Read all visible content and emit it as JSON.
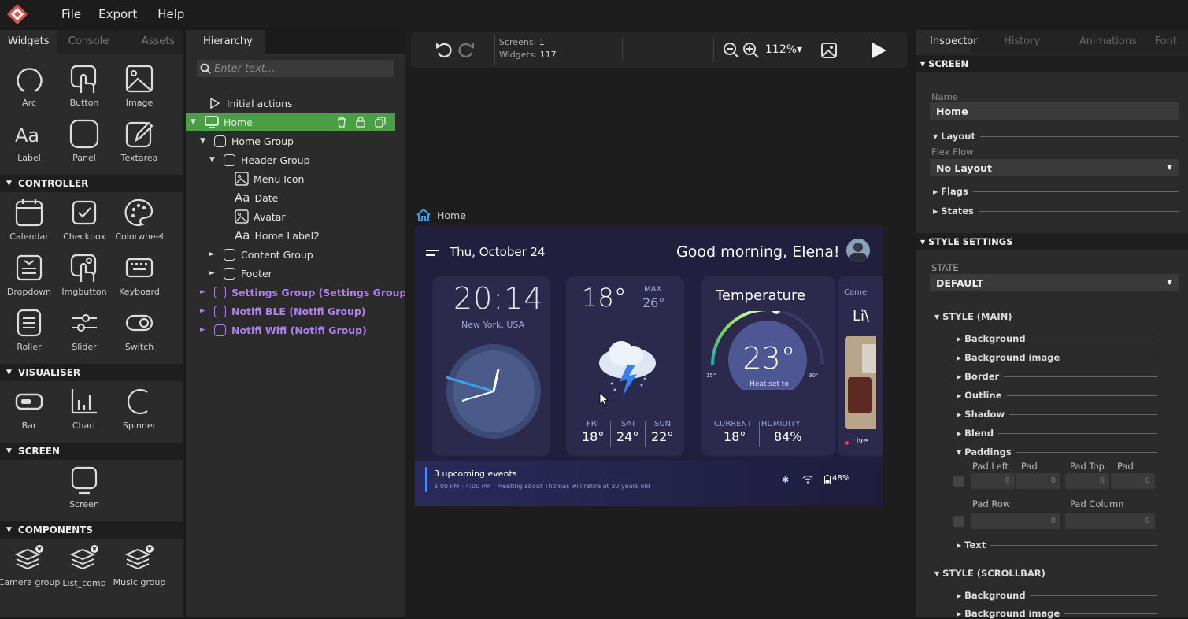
{
  "menu": {
    "file": "File",
    "export": "Export",
    "help": "Help"
  },
  "left_tabs": [
    "Widgets",
    "Console",
    "Assets"
  ],
  "widgets_basic": [
    {
      "label": "Arc",
      "icon": "arc-icon"
    },
    {
      "label": "Button",
      "icon": "button-icon"
    },
    {
      "label": "Image",
      "icon": "image-icon"
    },
    {
      "label": "Label",
      "icon": "label-icon"
    },
    {
      "label": "Panel",
      "icon": "panel-icon"
    },
    {
      "label": "Textarea",
      "icon": "textarea-icon"
    }
  ],
  "sections": {
    "controller": "CONTROLLER",
    "visualiser": "VISUALISER",
    "screen": "SCREEN",
    "components": "COMPONENTS"
  },
  "widgets_controller": [
    {
      "label": "Calendar",
      "icon": "calendar-icon"
    },
    {
      "label": "Checkbox",
      "icon": "checkbox-icon"
    },
    {
      "label": "Colorwheel",
      "icon": "colorwheel-icon"
    },
    {
      "label": "Dropdown",
      "icon": "dropdown-icon"
    },
    {
      "label": "Imgbutton",
      "icon": "imgbutton-icon"
    },
    {
      "label": "Keyboard",
      "icon": "keyboard-icon"
    },
    {
      "label": "Roller",
      "icon": "roller-icon"
    },
    {
      "label": "Slider",
      "icon": "slider-icon"
    },
    {
      "label": "Switch",
      "icon": "switch-icon"
    }
  ],
  "widgets_visualiser": [
    {
      "label": "Bar",
      "icon": "bar-icon"
    },
    {
      "label": "Chart",
      "icon": "chart-icon"
    },
    {
      "label": "Spinner",
      "icon": "spinner-icon"
    }
  ],
  "widget_screen": "Screen",
  "components": [
    "Camera group",
    "List_comp",
    "Music group"
  ],
  "hierarchy": {
    "tab": "Hierarchy",
    "search_placeholder": "Enter text...",
    "items": {
      "initial_actions": "Initial actions",
      "home": "Home",
      "home_group": "Home Group",
      "header_group": "Header Group",
      "menu_icon": "Menu Icon",
      "date": "Date",
      "avatar": "Avatar",
      "home_label2": "Home Label2",
      "content_group": "Content Group",
      "footer": "Footer",
      "settings_group": "Settings Group (Settings Group)",
      "notifi_ble": "Notifi BLE (Notifi Group)",
      "notifi_wifi": "Notifi Wifi (Notifi Group)"
    }
  },
  "toolbar": {
    "screens_label": "Screens:",
    "screens": "1",
    "widgets_label": "Widgets:",
    "widgets": "117",
    "zoom": "112%"
  },
  "canvas": {
    "breadcrumb": "Home"
  },
  "device": {
    "date": "Thu, October 24",
    "greeting": "Good morning, Elena!",
    "time": "20:14",
    "city": "New York, USA",
    "weather_temp": "18°",
    "max_label": "MAX",
    "max_temp": "26°",
    "forecast": [
      {
        "day": "FRI",
        "temp": "18°"
      },
      {
        "day": "SAT",
        "temp": "24°"
      },
      {
        "day": "SUN",
        "temp": "22°"
      }
    ],
    "temperature_title": "Temperature",
    "thermo_value": "23°",
    "thermo_caption": "Heat set to",
    "thermo_min": "15°",
    "thermo_max": "30°",
    "thermo_level": 0.55,
    "current_label": "CURRENT",
    "humidity_label": "HUMIDITY",
    "current_value": "18°",
    "humidity_value": "84%",
    "camera_title": "Came",
    "camera_live_big": "Li\\",
    "live": "Live",
    "events_title": "3 upcoming events",
    "events_detail": "3:00 PM - 4:00 PM : Meeting about Thomas will retire at 30 years old",
    "battery": "48%"
  },
  "inspector": {
    "tabs": [
      "Inspector",
      "History",
      "Animations",
      "Font"
    ],
    "screen_section": "SCREEN",
    "name_label": "Name",
    "name_value": "Home",
    "layout": "Layout",
    "flex_flow_label": "Flex Flow",
    "flex_flow_value": "No Layout",
    "flags": "Flags",
    "states": "States",
    "style_settings": "STYLE SETTINGS",
    "state_label": "STATE",
    "state_value": "DEFAULT",
    "style_main": "STYLE (MAIN)",
    "props": [
      "Background",
      "Background image",
      "Border",
      "Outline",
      "Shadow",
      "Blend"
    ],
    "paddings": "Paddings",
    "pad_left": "Pad Left",
    "pad": "Pad",
    "pad_top": "Pad Top",
    "pad2": "Pad",
    "pad_row": "Pad Row",
    "pad_column": "Pad Column",
    "zero": "0",
    "text": "Text",
    "style_scrollbar": "STYLE (SCROLLBAR)",
    "scroll_props": [
      "Background",
      "Background image"
    ]
  },
  "colors": {
    "accent_green": "#4caf50",
    "purple": "#b07ef0",
    "device_bg": "#201f3e"
  }
}
